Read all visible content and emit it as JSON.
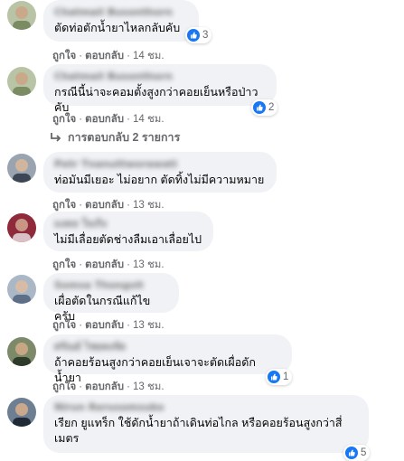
{
  "comments": [
    {
      "name": "Chatmail Busonthorn",
      "text": "ตัดท่อตักน้ำยาไหลกลับคับ",
      "time": "14 ชม.",
      "likes": "3"
    },
    {
      "name": "Chatmail Busonthorn",
      "text": "กรณีนี้น่าจะคอมตั้งสูงกว่าคอยเย็นหรือป่าวคับ",
      "time": "14 ชม.",
      "likes": "2"
    },
    {
      "name": "Petr Tnanuttworawati",
      "text": "ท่อมันมีเยอะ ไม่อยาก ตัดทิ้งไม่มีความหมาย",
      "time": "13 ชม.",
      "likes": ""
    },
    {
      "name": "มงคล ใจเกิง",
      "text": "ไม่มีเลื่อยตัดช่างลืมเอาเลื่อยไป",
      "time": "13 ชม.",
      "likes": ""
    },
    {
      "name": "Somsa Thongsit",
      "text": "เผื่อตัดในกรณีแก้ไขครับ",
      "time": "13 ชม.",
      "likes": ""
    },
    {
      "name": "ศรัณย์ ไชยคงจัด",
      "text": "ถ้าคอยร้อนสูงกว่าคอยเย็นเจาจะตัดเผื่อดักน้ำยา",
      "time": "13 ชม.",
      "likes": "1"
    },
    {
      "name": "Nirun Rerusomsuko",
      "text": "เรียก ยูแทร็ก ใช้ดักน้ำยาถ้าเดินท่อไกล หรือคอยร้อนสูงกว่าสี่ เมตร",
      "time": "",
      "likes": "5"
    }
  ],
  "actions": {
    "like": "ถูกใจ",
    "reply": "ตอบกลับ",
    "dot": "·"
  },
  "replies_link": "การตอบกลับ 2 รายการ",
  "colors": {
    "like_blue": "#1877f2",
    "bubble": "#f0f2f5",
    "meta": "#65676b"
  }
}
